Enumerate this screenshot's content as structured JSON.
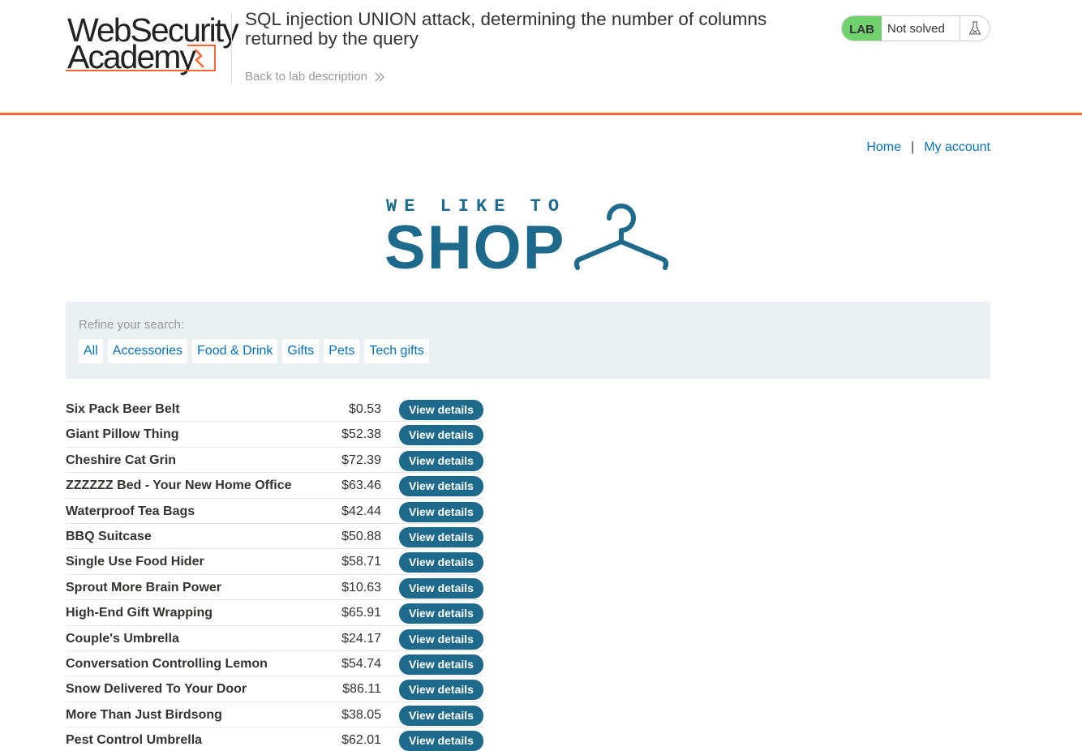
{
  "logo": {
    "line1": "WebSecurity",
    "line2": "Academy"
  },
  "lab": {
    "title": "SQL injection UNION attack, determining the number of columns returned by the query",
    "back_link": "Back to lab description",
    "badge": "LAB",
    "status": "Not solved",
    "accent_color": "#ff6633",
    "badge_color": "#70d16d"
  },
  "nav": {
    "home": "Home",
    "separator": "|",
    "account": "My account"
  },
  "banner": {
    "top": "WE LIKE TO",
    "main": "SHOP"
  },
  "filter": {
    "label": "Refine your search:",
    "categories": [
      "All",
      "Accessories",
      "Food & Drink",
      "Gifts",
      "Pets",
      "Tech gifts"
    ]
  },
  "products": [
    {
      "name": "Six Pack Beer Belt",
      "price": "$0.53",
      "button": "View details"
    },
    {
      "name": "Giant Pillow Thing",
      "price": "$52.38",
      "button": "View details"
    },
    {
      "name": "Cheshire Cat Grin",
      "price": "$72.39",
      "button": "View details"
    },
    {
      "name": "ZZZZZZ Bed - Your New Home Office",
      "price": "$63.46",
      "button": "View details"
    },
    {
      "name": "Waterproof Tea Bags",
      "price": "$42.44",
      "button": "View details"
    },
    {
      "name": "BBQ Suitcase",
      "price": "$50.88",
      "button": "View details"
    },
    {
      "name": "Single Use Food Hider",
      "price": "$58.71",
      "button": "View details"
    },
    {
      "name": "Sprout More Brain Power",
      "price": "$10.63",
      "button": "View details"
    },
    {
      "name": "High-End Gift Wrapping",
      "price": "$65.91",
      "button": "View details"
    },
    {
      "name": "Couple's Umbrella",
      "price": "$24.17",
      "button": "View details"
    },
    {
      "name": "Conversation Controlling Lemon",
      "price": "$54.74",
      "button": "View details"
    },
    {
      "name": "Snow Delivered To Your Door",
      "price": "$86.11",
      "button": "View details"
    },
    {
      "name": "More Than Just Birdsong",
      "price": "$38.05",
      "button": "View details"
    },
    {
      "name": "Pest Control Umbrella",
      "price": "$62.01",
      "button": "View details"
    }
  ],
  "colors": {
    "brand": "#1d6a8c",
    "link": "#0071bc"
  }
}
